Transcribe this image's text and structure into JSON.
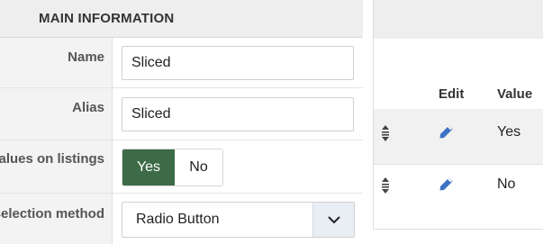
{
  "main_panel": {
    "header_title": "MAIN INFORMATION",
    "fields": {
      "name": {
        "label": "Name",
        "value": "Sliced"
      },
      "alias": {
        "label": "Alias",
        "value": "Sliced"
      },
      "values_on_listings": {
        "label": "Values on listings",
        "options": [
          "Yes",
          "No"
        ],
        "selected": "Yes"
      },
      "selection_method": {
        "label": "Selection method",
        "value": "Radio Button"
      }
    }
  },
  "values_panel": {
    "columns": {
      "edit": "Edit",
      "value": "Value"
    },
    "rows": [
      {
        "value": "Yes"
      },
      {
        "value": "No"
      }
    ]
  },
  "colors": {
    "toggle_active": "#3e6b47",
    "edit_icon": "#3d72c4",
    "header_background": "#eeeeee"
  },
  "icons": [
    "drag-handle-icon",
    "pencil-icon",
    "chevron-down-icon"
  ]
}
